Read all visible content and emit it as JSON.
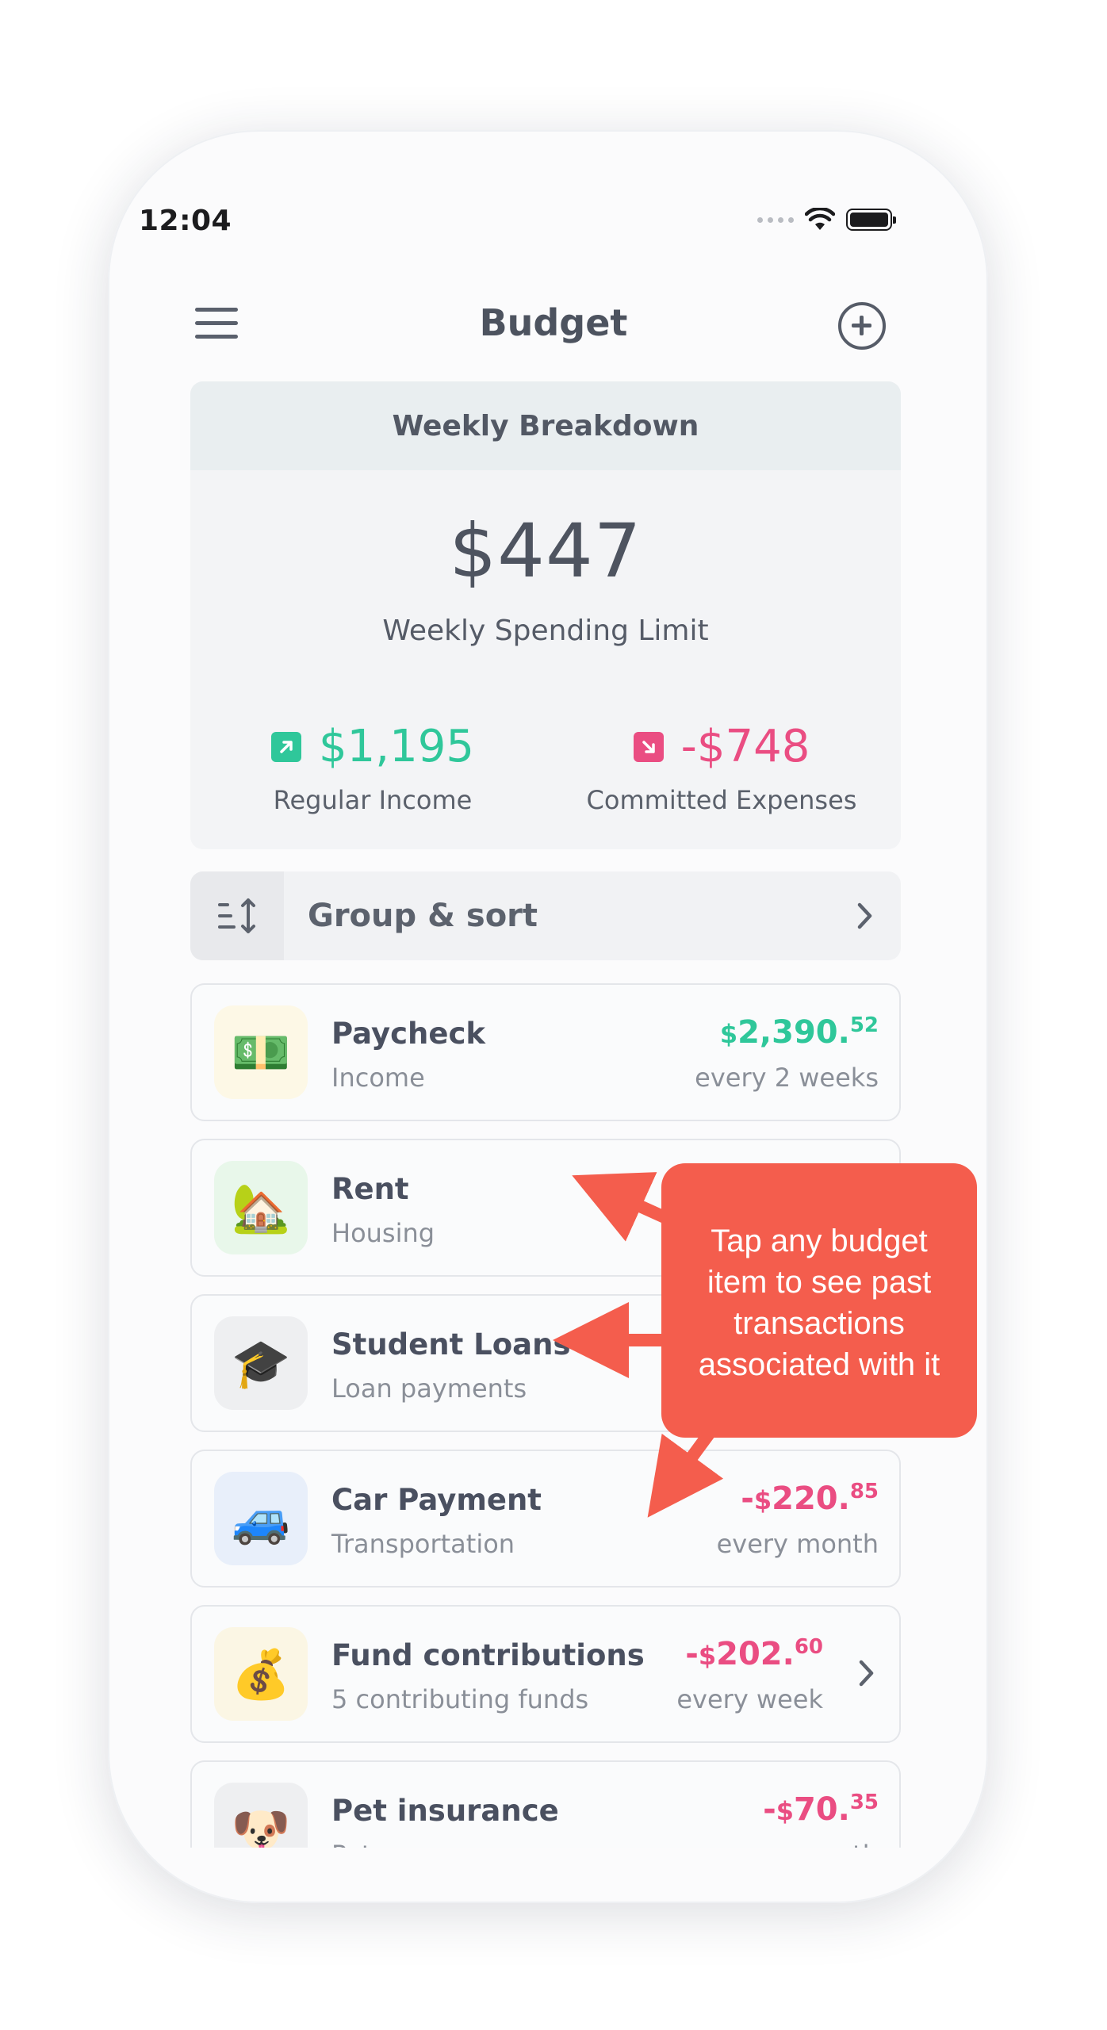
{
  "status_bar": {
    "time": "12:04"
  },
  "header": {
    "title": "Budget"
  },
  "weekly": {
    "heading": "Weekly Breakdown",
    "limit_amount": "$447",
    "limit_label": "Weekly Spending Limit",
    "income_value": "$1,195",
    "income_label": "Regular Income",
    "expense_value": "-$748",
    "expense_label": "Committed Expenses"
  },
  "group_sort": {
    "label": "Group & sort"
  },
  "items": [
    {
      "title": "Paycheck",
      "subtitle": "Income",
      "sign": "",
      "currency": "$",
      "whole": "2,390.",
      "cents": "52",
      "frequency": "every 2 weeks",
      "icon": "money-icon",
      "emoji": "💵"
    },
    {
      "title": "Rent",
      "subtitle": "Housing",
      "icon": "house-icon",
      "emoji": "🏡"
    },
    {
      "title": "Student Loans",
      "subtitle": "Loan payments",
      "icon": "graduation-cap-icon",
      "emoji": "🎓"
    },
    {
      "title": "Car Payment",
      "subtitle": "Transportation",
      "sign": "-",
      "currency": "$",
      "whole": "220.",
      "cents": "85",
      "frequency": "every month",
      "icon": "car-icon",
      "emoji": "🚙"
    },
    {
      "title": "Fund contributions",
      "subtitle": "5 contributing funds",
      "sign": "-",
      "currency": "$",
      "whole": "202.",
      "cents": "60",
      "frequency": "every week",
      "icon": "money-bag-icon",
      "emoji": "💰"
    },
    {
      "title": "Pet insurance",
      "subtitle": "Pet",
      "sign": "-",
      "currency": "$",
      "whole": "70.",
      "cents": "35",
      "frequency": "every month",
      "icon": "dog-icon",
      "emoji": "🐶"
    }
  ],
  "callout": {
    "text_lines": [
      "Tap any budget",
      "item to see past",
      "transactions",
      "associated with it"
    ]
  },
  "colors": {
    "income_green": "#2fc79a",
    "expense_pink": "#ea4d82",
    "callout_red": "#f45d4d"
  }
}
